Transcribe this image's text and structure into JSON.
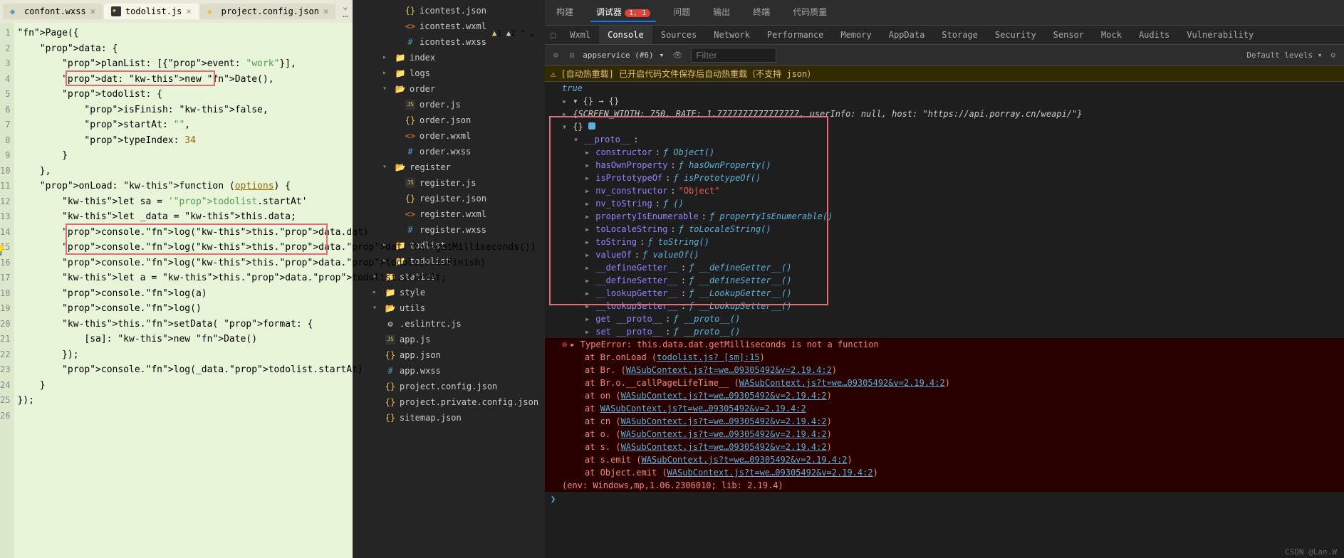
{
  "tabs": [
    {
      "icon": "wxss",
      "name": "confont.wxss"
    },
    {
      "icon": "js",
      "name": "todolist.js",
      "active": true
    },
    {
      "icon": "json",
      "name": "project.config.json"
    }
  ],
  "warnings": {
    "yellow": "1",
    "gray": "2"
  },
  "code_lines": [
    "Page({",
    "    data: {",
    "        planList: [{event: \"work\"}],",
    "        dat: new Date(),",
    "        todolist: {",
    "            isFinish: false,",
    "            startAt: \"\",",
    "            typeIndex: 34",
    "        }",
    "    },",
    "    onLoad: function (options) {",
    "        let sa = 'todolist.startAt'",
    "        let _data = this.data;",
    "        console.log(this.data.dat)",
    "        console.log(this.data.dat.getMilliseconds())",
    "        console.log(this.data.todolist.isFinish)",
    "        let a = this.data.todolist.startAt;",
    "        console.log(a)",
    "        console.log()",
    "        this.setData( format: {",
    "            [sa]: new Date()",
    "        });",
    "",
    "        console.log(_data.todolist.startAt)",
    "    }",
    "});"
  ],
  "file_tree": [
    {
      "depth": 1,
      "type": "json",
      "name": "icontest.json"
    },
    {
      "depth": 1,
      "type": "wxml",
      "name": "icontest.wxml"
    },
    {
      "depth": 1,
      "type": "wxss",
      "name": "icontest.wxss"
    },
    {
      "depth": 0,
      "type": "folder",
      "name": "index",
      "chev": "▸"
    },
    {
      "depth": 0,
      "type": "folder",
      "name": "logs",
      "chev": "▸"
    },
    {
      "depth": 0,
      "type": "folder-open",
      "name": "order",
      "chev": "▾"
    },
    {
      "depth": 1,
      "type": "js",
      "name": "order.js"
    },
    {
      "depth": 1,
      "type": "json",
      "name": "order.json"
    },
    {
      "depth": 1,
      "type": "wxml",
      "name": "order.wxml"
    },
    {
      "depth": 1,
      "type": "wxss",
      "name": "order.wxss"
    },
    {
      "depth": 0,
      "type": "folder-open",
      "name": "register",
      "chev": "▾"
    },
    {
      "depth": 1,
      "type": "js",
      "name": "register.js"
    },
    {
      "depth": 1,
      "type": "json",
      "name": "register.json"
    },
    {
      "depth": 1,
      "type": "wxml",
      "name": "register.wxml"
    },
    {
      "depth": 1,
      "type": "wxss",
      "name": "register.wxss"
    },
    {
      "depth": 0,
      "type": "folder",
      "name": "todlist",
      "chev": "▸"
    },
    {
      "depth": 0,
      "type": "folder",
      "name": "todolist",
      "chev": "▸"
    },
    {
      "depth": -1,
      "type": "folder",
      "name": "statics",
      "chev": "▸"
    },
    {
      "depth": -1,
      "type": "folder",
      "name": "style",
      "chev": "▸"
    },
    {
      "depth": -1,
      "type": "folder-open",
      "name": "utils",
      "chev": "▾"
    },
    {
      "depth": -1,
      "type": "config",
      "name": ".eslintrc.js"
    },
    {
      "depth": -1,
      "type": "js",
      "name": "app.js"
    },
    {
      "depth": -1,
      "type": "json",
      "name": "app.json"
    },
    {
      "depth": -1,
      "type": "wxss",
      "name": "app.wxss"
    },
    {
      "depth": -1,
      "type": "json",
      "name": "project.config.json"
    },
    {
      "depth": -1,
      "type": "json",
      "name": "project.private.config.json"
    },
    {
      "depth": -1,
      "type": "json",
      "name": "sitemap.json"
    }
  ],
  "devtools": {
    "tabs_top": [
      "构建",
      "调试器",
      "问题",
      "输出",
      "终端",
      "代码质量"
    ],
    "tabs_top_active": 1,
    "badge": "1, 1",
    "tabs_2": [
      "Wxml",
      "Console",
      "Sources",
      "Network",
      "Performance",
      "Memory",
      "AppData",
      "Storage",
      "Security",
      "Sensor",
      "Mock",
      "Audits",
      "Vulnerability"
    ],
    "tabs_2_active": 1,
    "context": "appservice (#6)",
    "filter_placeholder": "Filter",
    "levels": "Default levels ▾",
    "hot_reload_warn": "⚠ [自动热重载] 已开启代码文件保存后自动热重载（不支持 json）",
    "true_line": "true",
    "obj_header": "▾ {} → {}",
    "screen_info": "{SCREEN_WIDTH: 750, RATE: 1.7777777777777777, userInfo: null, host: \"https://api.porray.cn/weapi/\"}",
    "proto_lines": [
      {
        "k": "constructor",
        "v": "ƒ Object()"
      },
      {
        "k": "hasOwnProperty",
        "v": "ƒ hasOwnProperty()"
      },
      {
        "k": "isPrototypeOf",
        "v": "ƒ isPrototypeOf()"
      },
      {
        "k": "nv_constructor",
        "v": "\"Object\"",
        "str": true
      },
      {
        "k": "nv_toString",
        "v": "ƒ ()"
      },
      {
        "k": "propertyIsEnumerable",
        "v": "ƒ propertyIsEnumerable()"
      },
      {
        "k": "toLocaleString",
        "v": "ƒ toLocaleString()"
      },
      {
        "k": "toString",
        "v": "ƒ toString()"
      },
      {
        "k": "valueOf",
        "v": "ƒ valueOf()"
      },
      {
        "k": "__defineGetter__",
        "v": "ƒ __defineGetter__()"
      },
      {
        "k": "__defineSetter__",
        "v": "ƒ __defineSetter__()"
      },
      {
        "k": "__lookupGetter__",
        "v": "ƒ __LookupGetter__()"
      },
      {
        "k": "__lookupSetter__",
        "v": "ƒ __LookupSetter__()"
      },
      {
        "k": "get __proto__",
        "v": "ƒ __proto__()"
      },
      {
        "k": "set __proto__",
        "v": "ƒ __proto__()"
      }
    ],
    "error_msg": "▸ TypeError: this.data.dat.getMilliseconds is not a function",
    "stack": [
      {
        "pre": "at Br.onLoad (",
        "link": "todolist.js? [sm]:15",
        ")": ")"
      },
      {
        "pre": "at Br.<anonymous> (",
        "link": "WASubContext.js?t=we…09305492&v=2.19.4:2",
        ")": ")"
      },
      {
        "pre": "at Br.o.__callPageLifeTime__ (",
        "link": "WASubContext.js?t=we…09305492&v=2.19.4:2",
        ")": ")"
      },
      {
        "pre": "at on (",
        "link": "WASubContext.js?t=we…09305492&v=2.19.4:2",
        ")": ")"
      },
      {
        "pre": "at ",
        "link": "WASubContext.js?t=we…09305492&v=2.19.4:2",
        "": ""
      },
      {
        "pre": "at cn (",
        "link": "WASubContext.js?t=we…09305492&v=2.19.4:2",
        ")": ")"
      },
      {
        "pre": "at o.<anonymous> (",
        "link": "WASubContext.js?t=we…09305492&v=2.19.4:2",
        ")": ")"
      },
      {
        "pre": "at s.<anonymous> (",
        "link": "WASubContext.js?t=we…09305492&v=2.19.4:2",
        ")": ")"
      },
      {
        "pre": "at s.emit (",
        "link": "WASubContext.js?t=we…09305492&v=2.19.4:2",
        ")": ")"
      },
      {
        "pre": "at Object.emit (",
        "link": "WASubContext.js?t=we…09305492&v=2.19.4:2",
        ")": ")"
      }
    ],
    "env_line": "(env: Windows,mp,1.06.2306010; lib: 2.19.4)",
    "prompt": "❯"
  },
  "watermark": "CSDN @Lan.W"
}
